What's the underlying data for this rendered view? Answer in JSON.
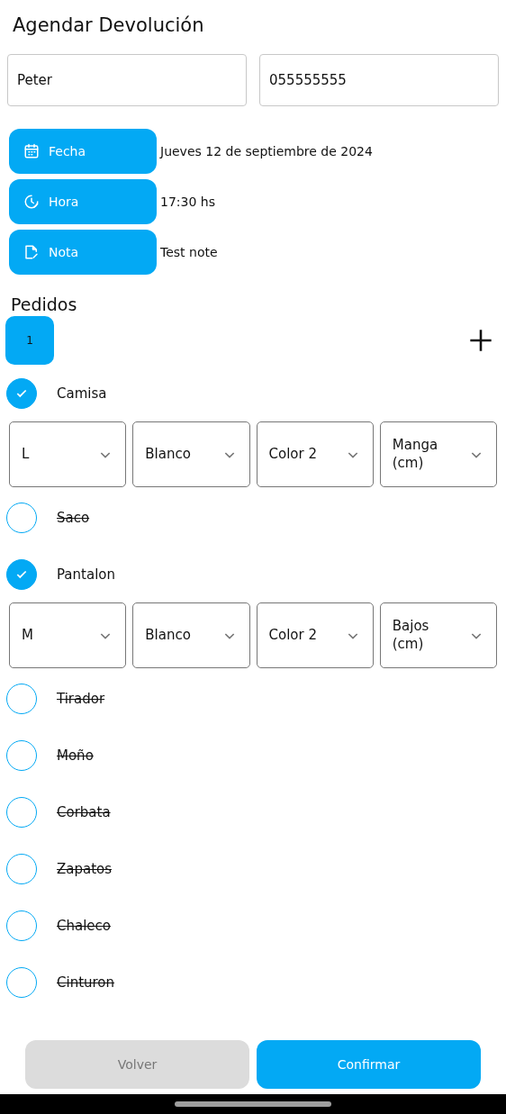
{
  "title": "Agendar Devolución",
  "fields": [
    {
      "value": "Peter"
    },
    {
      "value": "055555555"
    }
  ],
  "info": [
    {
      "kind": "calendar",
      "label": "Fecha",
      "value": "Jueves 12 de septiembre de 2024"
    },
    {
      "kind": "clock",
      "label": "Hora",
      "value": "17:30 hs"
    },
    {
      "kind": "note",
      "label": "Nota",
      "value": "Test note"
    }
  ],
  "orders_title": "Pedidos",
  "order_tabs": [
    {
      "label": "1",
      "selected": true
    }
  ],
  "items": [
    {
      "name": "Camisa",
      "checked": true,
      "selects": [
        "L",
        "Blanco",
        "Color 2",
        "Manga\n(cm)"
      ]
    },
    {
      "name": "Saco",
      "checked": false
    },
    {
      "name": "Pantalon",
      "checked": true,
      "selects": [
        "M",
        "Blanco",
        "Color 2",
        "Bajos\n(cm)"
      ]
    },
    {
      "name": "Tirador",
      "checked": false
    },
    {
      "name": "Moño",
      "checked": false
    },
    {
      "name": "Corbata",
      "checked": false
    },
    {
      "name": "Zapatos",
      "checked": false
    },
    {
      "name": "Chaleco",
      "checked": false
    },
    {
      "name": "Cinturon",
      "checked": false
    }
  ],
  "buttons": [
    {
      "kind": "secondary",
      "label": "Volver"
    },
    {
      "kind": "primary",
      "label": "Confirmar"
    }
  ]
}
